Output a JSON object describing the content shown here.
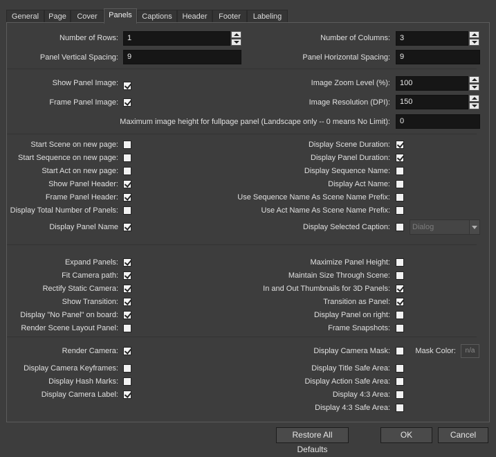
{
  "tabs": [
    "General",
    "Page",
    "Cover",
    "Panels",
    "Captions",
    "Header",
    "Footer",
    "Labeling"
  ],
  "active_tab": "Panels",
  "rows": {
    "label": "Number of Rows:",
    "value": "1"
  },
  "columns": {
    "label": "Number of Columns:",
    "value": "3"
  },
  "vspacing": {
    "label": "Panel Vertical Spacing:",
    "value": "9"
  },
  "hspacing": {
    "label": "Panel Horizontal Spacing:",
    "value": "9"
  },
  "show_panel_image": {
    "label": "Show Panel Image:",
    "checked": true
  },
  "frame_panel_image": {
    "label": "Frame Panel Image:",
    "checked": true
  },
  "zoom": {
    "label": "Image Zoom Level (%):",
    "value": "100"
  },
  "resolution": {
    "label": "Image Resolution (DPI):",
    "value": "150"
  },
  "max_height": {
    "label": "Maximum image height for fullpage panel (Landscape only -- 0 means No Limit):",
    "value": "0"
  },
  "group1_left": [
    {
      "label": "Start Scene on new page:",
      "checked": false
    },
    {
      "label": "Start Sequence on new page:",
      "checked": false
    },
    {
      "label": "Start Act on new page:",
      "checked": false
    },
    {
      "label": "Show Panel Header:",
      "checked": true
    },
    {
      "label": "Frame Panel Header:",
      "checked": true
    },
    {
      "label": "Display Total Number of Panels:",
      "checked": false
    },
    {
      "label": "Display Panel Name",
      "checked": true
    }
  ],
  "group1_right": [
    {
      "label": "Display Scene Duration:",
      "checked": true
    },
    {
      "label": "Display Panel Duration:",
      "checked": true
    },
    {
      "label": "Display Sequence Name:",
      "checked": false
    },
    {
      "label": "Display Act Name:",
      "checked": false
    },
    {
      "label": "Use Sequence Name As Scene Name Prefix:",
      "checked": false
    },
    {
      "label": "Use Act Name As Scene Name Prefix:",
      "checked": false
    },
    {
      "label": "Display Selected Caption:",
      "checked": false
    }
  ],
  "caption_select": "Dialog",
  "group2_left": [
    {
      "label": "Expand Panels:",
      "checked": true
    },
    {
      "label": "Fit Camera path:",
      "checked": true
    },
    {
      "label": "Rectify Static Camera:",
      "checked": true
    },
    {
      "label": "Show Transition:",
      "checked": true
    },
    {
      "label": "Display \"No Panel\" on board:",
      "checked": true
    },
    {
      "label": "Render Scene Layout Panel:",
      "checked": false
    }
  ],
  "group2_right": [
    {
      "label": "Maximize Panel Height:",
      "checked": false
    },
    {
      "label": "Maintain Size Through Scene:",
      "checked": false
    },
    {
      "label": "In and Out Thumbnails for 3D Panels:",
      "checked": true
    },
    {
      "label": "Transition as Panel:",
      "checked": true
    },
    {
      "label": "Display Panel on right:",
      "checked": false
    },
    {
      "label": "Frame Snapshots:",
      "checked": false
    }
  ],
  "group3_left": [
    {
      "label": "Render Camera:",
      "checked": true
    },
    {
      "label": "Display Camera Keyframes:",
      "checked": false
    },
    {
      "label": "Display Hash Marks:",
      "checked": false
    },
    {
      "label": "Display Camera Label:",
      "checked": true
    }
  ],
  "group3_right": [
    {
      "label": "Display Camera Mask:",
      "checked": false
    },
    {
      "label": "Display Title Safe Area:",
      "checked": false
    },
    {
      "label": "Display Action Safe Area:",
      "checked": false
    },
    {
      "label": "Display 4:3 Area:",
      "checked": false
    },
    {
      "label": "Display 4:3 Safe Area:",
      "checked": false
    }
  ],
  "mask_color": {
    "label": "Mask Color:",
    "value": "n/a"
  },
  "buttons": {
    "restore": "Restore All Defaults",
    "ok": "OK",
    "cancel": "Cancel"
  }
}
